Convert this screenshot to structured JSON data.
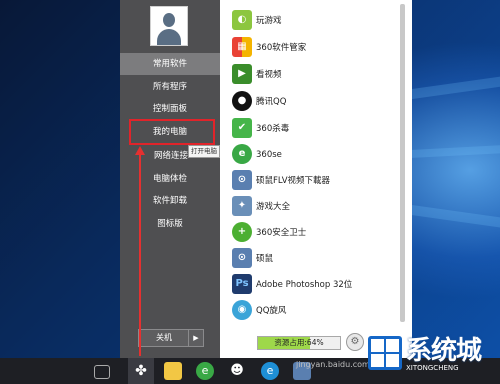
{
  "start_menu": {
    "left_items": [
      {
        "label": "常用软件",
        "selected": true
      },
      {
        "label": "所有程序"
      },
      {
        "label": "控制面板"
      },
      {
        "label": "我的电脑"
      },
      {
        "label": "网络连接"
      },
      {
        "label": "电脑体检"
      },
      {
        "label": "软件卸载"
      },
      {
        "label": "图标版"
      }
    ],
    "tooltip": "打开电脑",
    "shutdown_label": "关机",
    "apps": [
      {
        "label": "玩游戏",
        "icon": "gamepad-icon",
        "color": "#8cc63f"
      },
      {
        "label": "360软件管家",
        "icon": "software-manager-icon",
        "color": "#f4a11a"
      },
      {
        "label": "看视频",
        "icon": "video-icon",
        "color": "#3a8d2b"
      },
      {
        "label": "腾讯QQ",
        "icon": "qq-penguin-icon",
        "color": "#111111"
      },
      {
        "label": "360杀毒",
        "icon": "antivirus-shield-icon",
        "color": "#45b549"
      },
      {
        "label": "360se",
        "icon": "browser-icon",
        "color": "#39a845"
      },
      {
        "label": "硕鼠FLV视频下載器",
        "icon": "mouse-downloader-icon",
        "color": "#5a7fb0"
      },
      {
        "label": "游戏大全",
        "icon": "games-collection-icon",
        "color": "#6a8fb8"
      },
      {
        "label": "360安全卫士",
        "icon": "security-guard-icon",
        "color": "#4caf32"
      },
      {
        "label": "硕鼠",
        "icon": "mouse-icon",
        "color": "#5a7fb0"
      },
      {
        "label": "Adobe Photoshop 32位",
        "icon": "photoshop-icon",
        "color": "#1f3b6d"
      },
      {
        "label": "QQ旋风",
        "icon": "qq-whirlwind-icon",
        "color": "#3aa4d8"
      }
    ],
    "resource_label": "资源占用:64%",
    "resource_percent": 64
  },
  "watermark": "jingyan.baidu.com",
  "logo": {
    "text": "系统城",
    "sub": "XITONGCHENG"
  },
  "taskbar": {
    "icons": [
      "task-view-icon",
      "fan-start-icon",
      "file-explorer-icon",
      "360-browser-icon",
      "qq-icon",
      "ie-icon",
      "app-icon"
    ]
  }
}
